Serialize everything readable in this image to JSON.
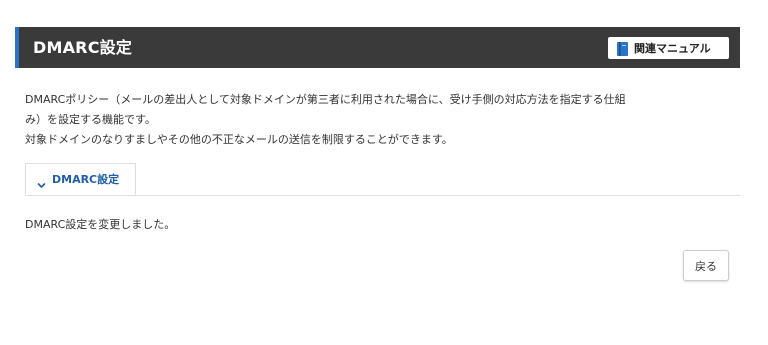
{
  "header": {
    "title": "DMARC設定",
    "manual_button_label": "関連マニュアル",
    "manual_icon": "book-icon"
  },
  "description": {
    "line1": "DMARCポリシー（メールの差出人として対象ドメインが第三者に利用された場合に、受け手側の対応方法を指定する仕組",
    "line2": "み）を設定する機能です。",
    "line3": "対象ドメインのなりすましやその他の不正なメールの送信を制限することができます。"
  },
  "tabs": [
    {
      "label": "DMARC設定",
      "icon": "chevron-down-icon",
      "active": true
    }
  ],
  "status": {
    "message": "DMARC設定を変更しました。"
  },
  "actions": {
    "back_label": "戻る"
  },
  "colors": {
    "header_bg": "#3a3a3a",
    "header_accent": "#2b73c8",
    "tab_text": "#1f5fa8",
    "icon_blue": "#2b73c8"
  }
}
